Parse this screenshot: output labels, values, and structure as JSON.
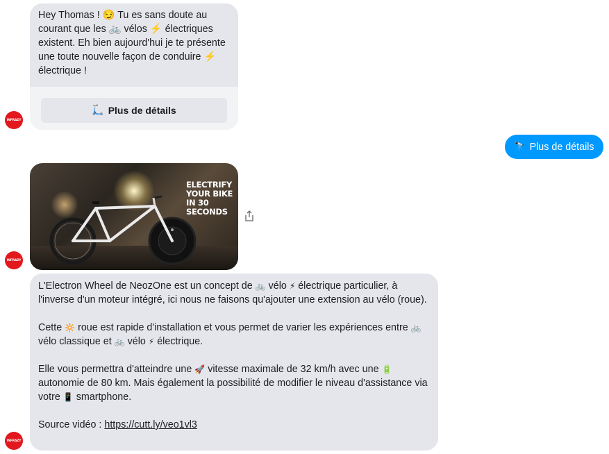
{
  "bot": {
    "avatar_text": "INFRAZY"
  },
  "messages": {
    "card": {
      "text": "Hey Thomas ! 😏 Tu es sans doute au courant que les 🚲 vélos ⚡ électriques existent. Eh bien aujourd'hui je te présente une toute nouvelle façon de conduire ⚡ électrique !",
      "button_label": "Plus de détails",
      "button_icon": "🛴"
    },
    "user_reply": {
      "icon": "🔭",
      "label": "Plus de détails"
    },
    "media": {
      "overlay_line1": "ELECTRIFY",
      "overlay_line2": "YOUR BIKE",
      "overlay_line3": "IN 30",
      "overlay_line4": "SECONDS"
    },
    "details": {
      "p1_a": "L'Electron Wheel de NeozOne est un concept de ",
      "p1_b": " vélo ",
      "p1_c": " électrique particulier, à l'inverse d'un moteur intégré, ici nous ne faisons qu'ajouter une extension au vélo (roue).",
      "p2_a": "Cette ",
      "p2_b": " roue est rapide d'installation et vous permet de varier les expériences entre ",
      "p2_c": " vélo classique et ",
      "p2_d": " vélo ",
      "p2_e": " électrique.",
      "p3_a": "Elle vous permettra d'atteindre une ",
      "p3_b": " vitesse maximale de 32 km/h avec une ",
      "p3_c": " autonomie de 80 km. Mais également la possibilité de modifier le niveau d'assistance via votre ",
      "p3_d": " smartphone.",
      "source_label": "Source vidéo : ",
      "source_link": "https://cutt.ly/veo1vl3",
      "emoji_bike": "🚲",
      "emoji_bolt": "⚡",
      "emoji_wheel": "🔆",
      "emoji_rocket": "🚀",
      "emoji_battery": "🔋",
      "emoji_phone": "📱"
    }
  }
}
